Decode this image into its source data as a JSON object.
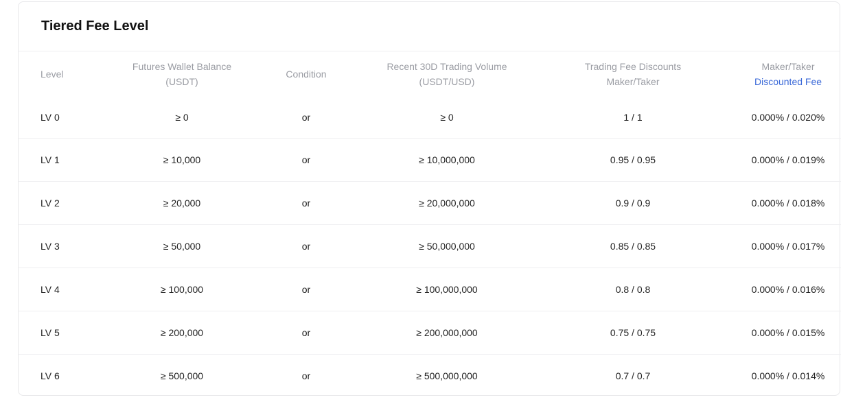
{
  "title": "Tiered Fee Level",
  "headers": {
    "level": "Level",
    "balance_line1": "Futures Wallet Balance",
    "balance_line2": "(USDT)",
    "condition": "Condition",
    "volume_line1": "Recent 30D Trading Volume",
    "volume_line2": "(USDT/USD)",
    "discount_line1": "Trading Fee Discounts",
    "discount_line2": "Maker/Taker",
    "fee_line1": "Maker/Taker",
    "fee_line2": "Discounted Fee"
  },
  "colors": {
    "header_text": "#9a9ca3",
    "accent_link": "#3b69d8",
    "body_text": "#222222"
  },
  "rows": [
    {
      "level": "LV 0",
      "balance": "≥ 0",
      "condition": "or",
      "volume": "≥ 0",
      "discount": "1 / 1",
      "fee": "0.000% / 0.020%"
    },
    {
      "level": "LV 1",
      "balance": "≥ 10,000",
      "condition": "or",
      "volume": "≥ 10,000,000",
      "discount": "0.95 / 0.95",
      "fee": "0.000% / 0.019%"
    },
    {
      "level": "LV 2",
      "balance": "≥ 20,000",
      "condition": "or",
      "volume": "≥ 20,000,000",
      "discount": "0.9 / 0.9",
      "fee": "0.000% / 0.018%"
    },
    {
      "level": "LV 3",
      "balance": "≥ 50,000",
      "condition": "or",
      "volume": "≥ 50,000,000",
      "discount": "0.85 / 0.85",
      "fee": "0.000% / 0.017%"
    },
    {
      "level": "LV 4",
      "balance": "≥ 100,000",
      "condition": "or",
      "volume": "≥ 100,000,000",
      "discount": "0.8 / 0.8",
      "fee": "0.000% / 0.016%"
    },
    {
      "level": "LV 5",
      "balance": "≥ 200,000",
      "condition": "or",
      "volume": "≥ 200,000,000",
      "discount": "0.75 / 0.75",
      "fee": "0.000% / 0.015%"
    },
    {
      "level": "LV 6",
      "balance": "≥ 500,000",
      "condition": "or",
      "volume": "≥ 500,000,000",
      "discount": "0.7 / 0.7",
      "fee": "0.000% / 0.014%"
    }
  ]
}
